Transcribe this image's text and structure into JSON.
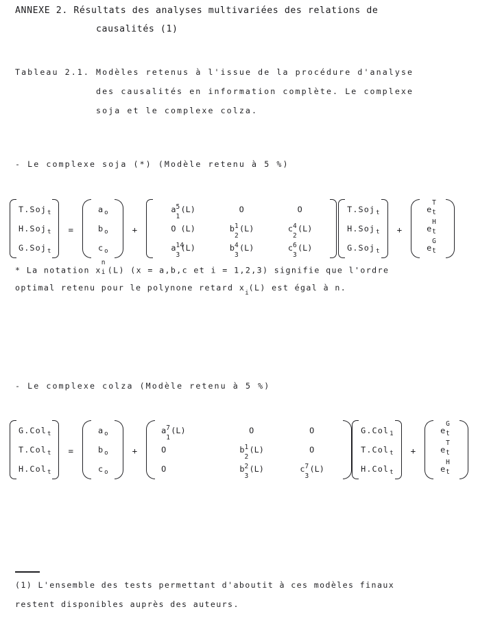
{
  "document": {
    "heading": {
      "line1": "ANNEXE  2.  Résultats  des  analyses  multivariées  des  relations  de",
      "line2": "causalités (1)"
    },
    "table_caption": {
      "line1": "Tableau  2.1.  Modèles  retenus  à  l'issue  de  la  procédure  d'analyse",
      "line2": "des  causalités  en  information  complète.  Le  complexe",
      "line3": "soja  et  le  complexe  colza."
    },
    "sections": [
      {
        "id": "soja",
        "heading": "- Le complexe soja (*) (Modèle retenu à 5 %)",
        "equation": {
          "lhs_vector": {
            "rows": [
              {
                "label": "T.Soj",
                "sub": "t"
              },
              {
                "label": "H.Soj",
                "sub": "t"
              },
              {
                "label": "G.Soj",
                "sub": "t"
              }
            ]
          },
          "equals": "=",
          "constant_vector": {
            "rows": [
              {
                "label": "a",
                "sub": "o"
              },
              {
                "label": "b",
                "sub": "o"
              },
              {
                "label": "c",
                "sub": "o"
              }
            ]
          },
          "plus1": "+",
          "coefficient_matrix": {
            "rows": [
              [
                {
                  "base": "a",
                  "sup": "5",
                  "sub": "1",
                  "tail": "(L)"
                },
                {
                  "base": "O",
                  "sup": "",
                  "sub": "",
                  "tail": ""
                },
                {
                  "base": "O",
                  "sup": "",
                  "sub": "",
                  "tail": ""
                }
              ],
              [
                {
                  "base": "O",
                  "sup": "",
                  "sub": "",
                  "tail": "(L)"
                },
                {
                  "base": "b",
                  "sup": "1",
                  "sub": "2",
                  "tail": "(L)"
                },
                {
                  "base": "c",
                  "sup": "4",
                  "sub": "2",
                  "tail": "(L)"
                }
              ],
              [
                {
                  "base": "a",
                  "sup": "14",
                  "sub": "3",
                  "tail": "(L)"
                },
                {
                  "base": "b",
                  "sup": "4",
                  "sub": "3",
                  "tail": "(L)"
                },
                {
                  "base": "c",
                  "sup": "6",
                  "sub": "3",
                  "tail": "(L)"
                }
              ]
            ]
          },
          "rhs_vector": {
            "rows": [
              {
                "label": "T.Soj",
                "sub": "t"
              },
              {
                "label": "H.Soj",
                "sub": "t"
              },
              {
                "label": "G.Soj",
                "sub": "t"
              }
            ]
          },
          "plus2": "+",
          "error_vector": {
            "rows": [
              {
                "base": "e",
                "sup": "T",
                "sub": "t"
              },
              {
                "base": "e",
                "sup": "H",
                "sub": "t"
              },
              {
                "base": "e",
                "sup": "G",
                "sub": "t"
              }
            ]
          }
        },
        "footnote": {
          "line1_a": "* La notation x",
          "line1_stack_up": "n",
          "line1_stack_dn": "i",
          "line1_b": "(L)  (x = a,b,c et i = 1,2,3)  signifie que l'ordre",
          "line2_a": "optimal retenu pour le polynone retard x",
          "line2_sub": "i",
          "line2_b": "(L) est égal à n."
        }
      },
      {
        "id": "colza",
        "heading": "- Le complexe colza (Modèle retenu à 5 %)",
        "equation": {
          "lhs_vector": {
            "rows": [
              {
                "label": "G.Col",
                "sub": "t"
              },
              {
                "label": "T.Col",
                "sub": "t"
              },
              {
                "label": "H.Col",
                "sub": "t"
              }
            ]
          },
          "equals": "=",
          "constant_vector": {
            "rows": [
              {
                "label": "a",
                "sub": "o"
              },
              {
                "label": "b",
                "sub": "o"
              },
              {
                "label": "c",
                "sub": "o"
              }
            ]
          },
          "plus1": "+",
          "coefficient_matrix": {
            "rows": [
              [
                {
                  "base": "a",
                  "sup": "7",
                  "sub": "1",
                  "tail": "(L)"
                },
                {
                  "base": "O",
                  "sup": "",
                  "sub": "",
                  "tail": ""
                },
                {
                  "base": "O",
                  "sup": "",
                  "sub": "",
                  "tail": ""
                }
              ],
              [
                {
                  "base": "O",
                  "sup": "",
                  "sub": "",
                  "tail": ""
                },
                {
                  "base": "b",
                  "sup": "1",
                  "sub": "2",
                  "tail": "(L)"
                },
                {
                  "base": "O",
                  "sup": "",
                  "sub": "",
                  "tail": ""
                }
              ],
              [
                {
                  "base": "O",
                  "sup": "",
                  "sub": "",
                  "tail": ""
                },
                {
                  "base": "b",
                  "sup": "2",
                  "sub": "3",
                  "tail": "(L)"
                },
                {
                  "base": "c",
                  "sup": "7",
                  "sub": "3",
                  "tail": "(L)"
                }
              ]
            ]
          },
          "rhs_vector": {
            "rows": [
              {
                "label": "G.Col",
                "sub": "1"
              },
              {
                "label": "T.Col",
                "sub": "t"
              },
              {
                "label": "H.Col",
                "sub": "t"
              }
            ]
          },
          "plus2": "+",
          "error_vector": {
            "rows": [
              {
                "base": "e",
                "sup": "G",
                "sub": "t"
              },
              {
                "base": "e",
                "sup": "T",
                "sub": "t"
              },
              {
                "base": "e",
                "sup": "H",
                "sub": "t"
              }
            ]
          }
        }
      }
    ],
    "page_footnote": {
      "line1": "(1) L'ensemble des tests permettant d'aboutit à ces modèles finaux",
      "line2": "restent disponibles auprès des auteurs."
    }
  }
}
